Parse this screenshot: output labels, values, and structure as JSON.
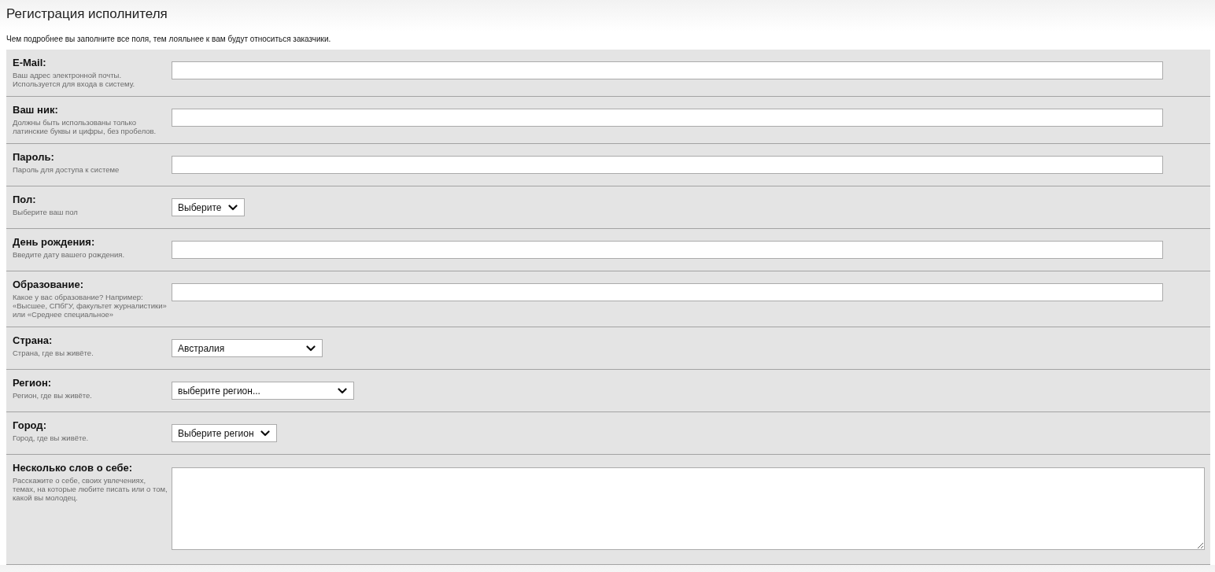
{
  "page": {
    "title": "Регистрация исполнителя",
    "subtitle": "Чем подробнее вы заполните все поля, тем лояльнее к вам будут относиться заказчики."
  },
  "fields": [
    {
      "kind": "text",
      "label": "E-Mail:",
      "hint": "Ваш адрес электронной почты.\nИспользуется для входа в систему."
    },
    {
      "kind": "text",
      "label": "Ваш ник:",
      "hint": "Должны быть использованы только\nлатинские буквы и цифры, без пробелов."
    },
    {
      "kind": "text",
      "label": "Пароль:",
      "hint": "Пароль для доступа к системе"
    },
    {
      "kind": "select",
      "label": "Пол:",
      "hint": "Выберите ваш пол",
      "value": "Выберите"
    },
    {
      "kind": "text",
      "label": "День рождения:",
      "hint": "Введите дату вашего рождения."
    },
    {
      "kind": "text",
      "label": "Образование:",
      "hint": "Какое у вас образование? Например:\n«Высшее, СПбГУ, факультет журналистики»\nили «Среднее специальное»"
    },
    {
      "kind": "select",
      "label": "Страна:",
      "hint": "Страна, где вы живёте.",
      "value": "Австралия"
    },
    {
      "kind": "select",
      "label": "Регион:",
      "hint": "Регион, где вы живёте.",
      "value": "выберите регион..."
    },
    {
      "kind": "select",
      "label": "Город:",
      "hint": "Город, где вы живёте.",
      "value": "Выберите регион"
    },
    {
      "kind": "textarea",
      "label": "Несколько слов о себе:",
      "hint": "Расскажите о себе, своих увлечениях,\nтемах, на которые любите писать или о том,\nкакой вы молодец."
    }
  ]
}
